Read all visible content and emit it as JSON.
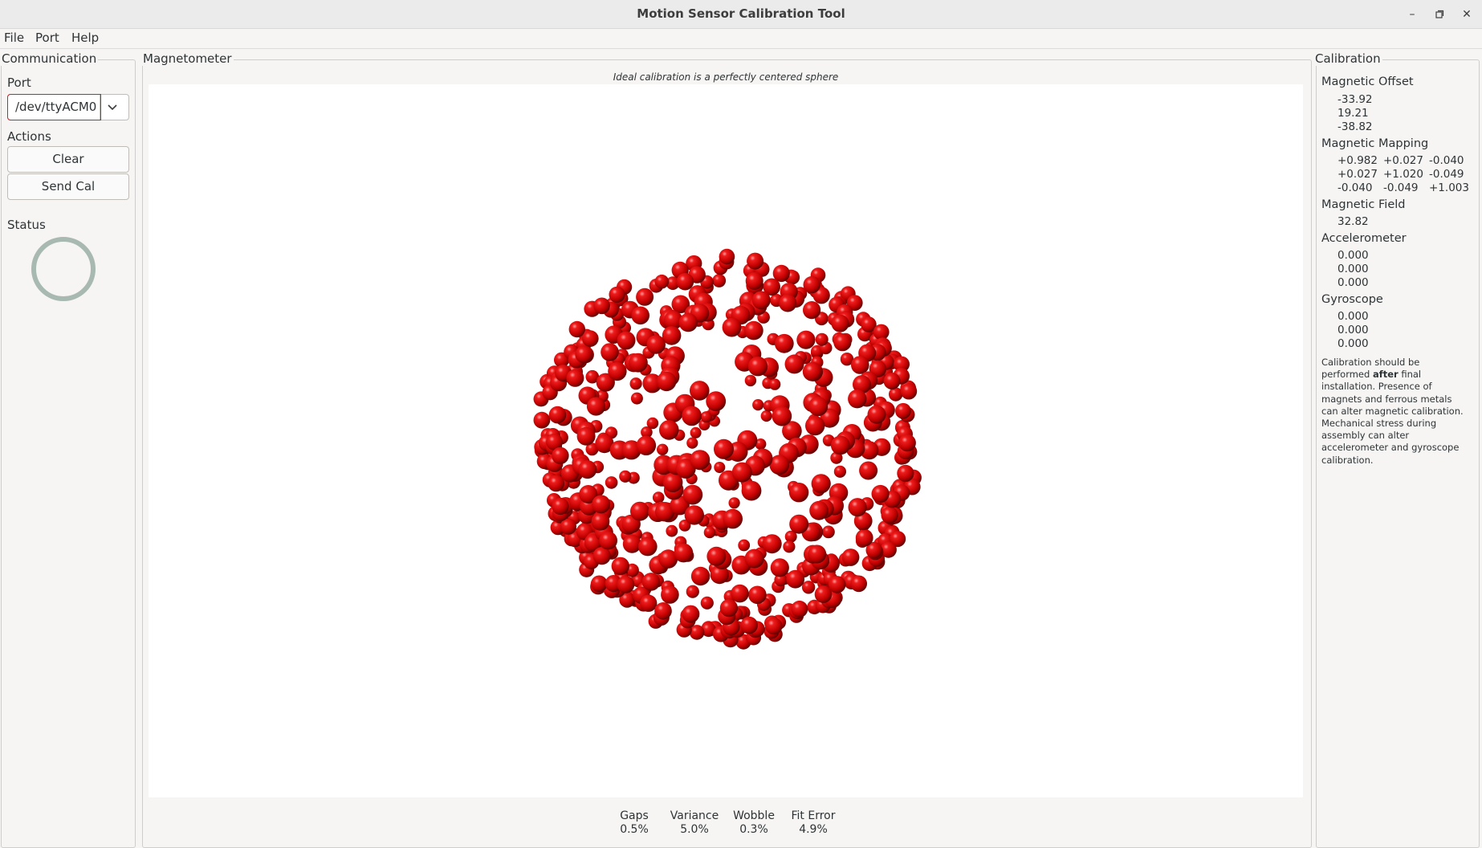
{
  "window": {
    "title": "Motion Sensor Calibration Tool"
  },
  "menu": {
    "items": [
      "File",
      "Port",
      "Help"
    ]
  },
  "communication": {
    "title": "Communication",
    "port_label": "Port",
    "port_value": "/dev/ttyACM0",
    "actions_label": "Actions",
    "clear_button": "Clear",
    "send_cal_button": "Send Cal",
    "status_label": "Status",
    "status_ring_color": "#a7b9b0"
  },
  "magnetometer": {
    "title": "Magnetometer",
    "caption": "Ideal calibration is a perfectly centered sphere",
    "point_color": "#e00000",
    "stats": [
      {
        "label": "Gaps",
        "value": "0.5%"
      },
      {
        "label": "Variance",
        "value": "5.0%"
      },
      {
        "label": "Wobble",
        "value": "0.3%"
      },
      {
        "label": "Fit Error",
        "value": "4.9%"
      }
    ]
  },
  "calibration": {
    "title": "Calibration",
    "magnetic_offset": {
      "label": "Magnetic Offset",
      "values": [
        "-33.92",
        "19.21",
        "-38.82"
      ]
    },
    "magnetic_mapping": {
      "label": "Magnetic Mapping",
      "rows": [
        [
          "+0.982",
          "+0.027",
          "-0.040"
        ],
        [
          "+0.027",
          "+1.020",
          "-0.049"
        ],
        [
          "-0.040",
          "-0.049",
          "+1.003"
        ]
      ]
    },
    "magnetic_field": {
      "label": "Magnetic Field",
      "value": "32.82"
    },
    "accelerometer": {
      "label": "Accelerometer",
      "values": [
        "0.000",
        "0.000",
        "0.000"
      ]
    },
    "gyroscope": {
      "label": "Gyroscope",
      "values": [
        "0.000",
        "0.000",
        "0.000"
      ]
    },
    "note": {
      "text_before": "Calibration should be performed ",
      "bold": "after",
      "text_after": " final installation.  Presence of magnets and ferrous metals can alter magnetic calibration. Mechanical stress during assembly can alter accelerometer and gyroscope calibration."
    }
  }
}
